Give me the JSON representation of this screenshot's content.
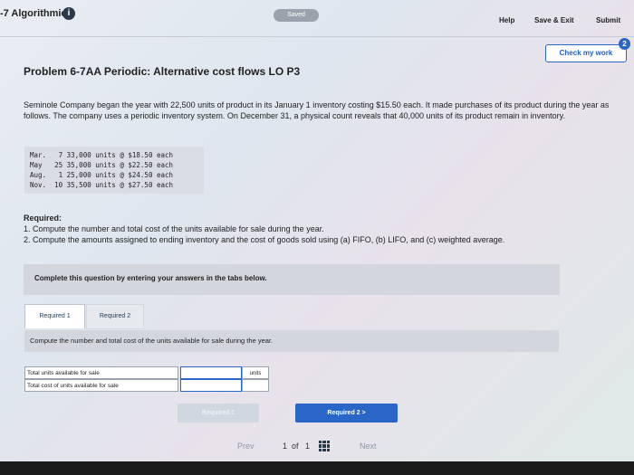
{
  "header": {
    "app_title": "-7 Algorithmic",
    "info_icon": "info-icon",
    "saved_label": "Saved",
    "help_label": "Help",
    "save_exit_label": "Save & Exit",
    "submit_label": "Submit",
    "check_work_label": "Check my work",
    "check_badge": "2"
  },
  "problem": {
    "title": "Problem 6-7AA Periodic: Alternative cost flows LO P3",
    "intro": "Seminole Company began the year with 22,500 units of product in its January 1 inventory costing $15.50 each. It made purchases of its product during the year as follows. The company uses a periodic inventory system. On December 31, a physical count reveals that 40,000 units of its product remain in inventory.",
    "purchases": [
      "Mar.   7 33,000 units @ $18.50 each",
      "May   25 35,000 units @ $22.50 each",
      "Aug.   1 25,000 units @ $24.50 each",
      "Nov.  10 35,500 units @ $27.50 each"
    ],
    "required_heading": "Required:",
    "required_1": "1. Compute the number and total cost of the units available for sale during the year.",
    "required_2": "2. Compute the amounts assigned to ending inventory and the cost of goods sold using (a) FIFO, (b) LIFO, and (c) weighted average."
  },
  "workspace": {
    "complete_prompt": "Complete this question by entering your answers in the tabs below.",
    "tabs": [
      {
        "label": "Required 1"
      },
      {
        "label": "Required 2"
      }
    ],
    "instruction": "Compute the number and total cost of the units available for sale during the year.",
    "rows": [
      {
        "label": "Total units available for sale",
        "value": "",
        "unit": "units"
      },
      {
        "label": "Total cost of units available for sale",
        "value": "",
        "unit": ""
      }
    ],
    "prev_button": "Required 1",
    "next_button": "Required 2  >"
  },
  "pager": {
    "prev_label": "Prev",
    "page_current": "1",
    "page_of": "of",
    "page_total": "1",
    "next_label": "Next",
    "grid_icon": "grid-icon"
  },
  "colors": {
    "accent": "#2a66c8",
    "panel": "#d3d7dd"
  }
}
